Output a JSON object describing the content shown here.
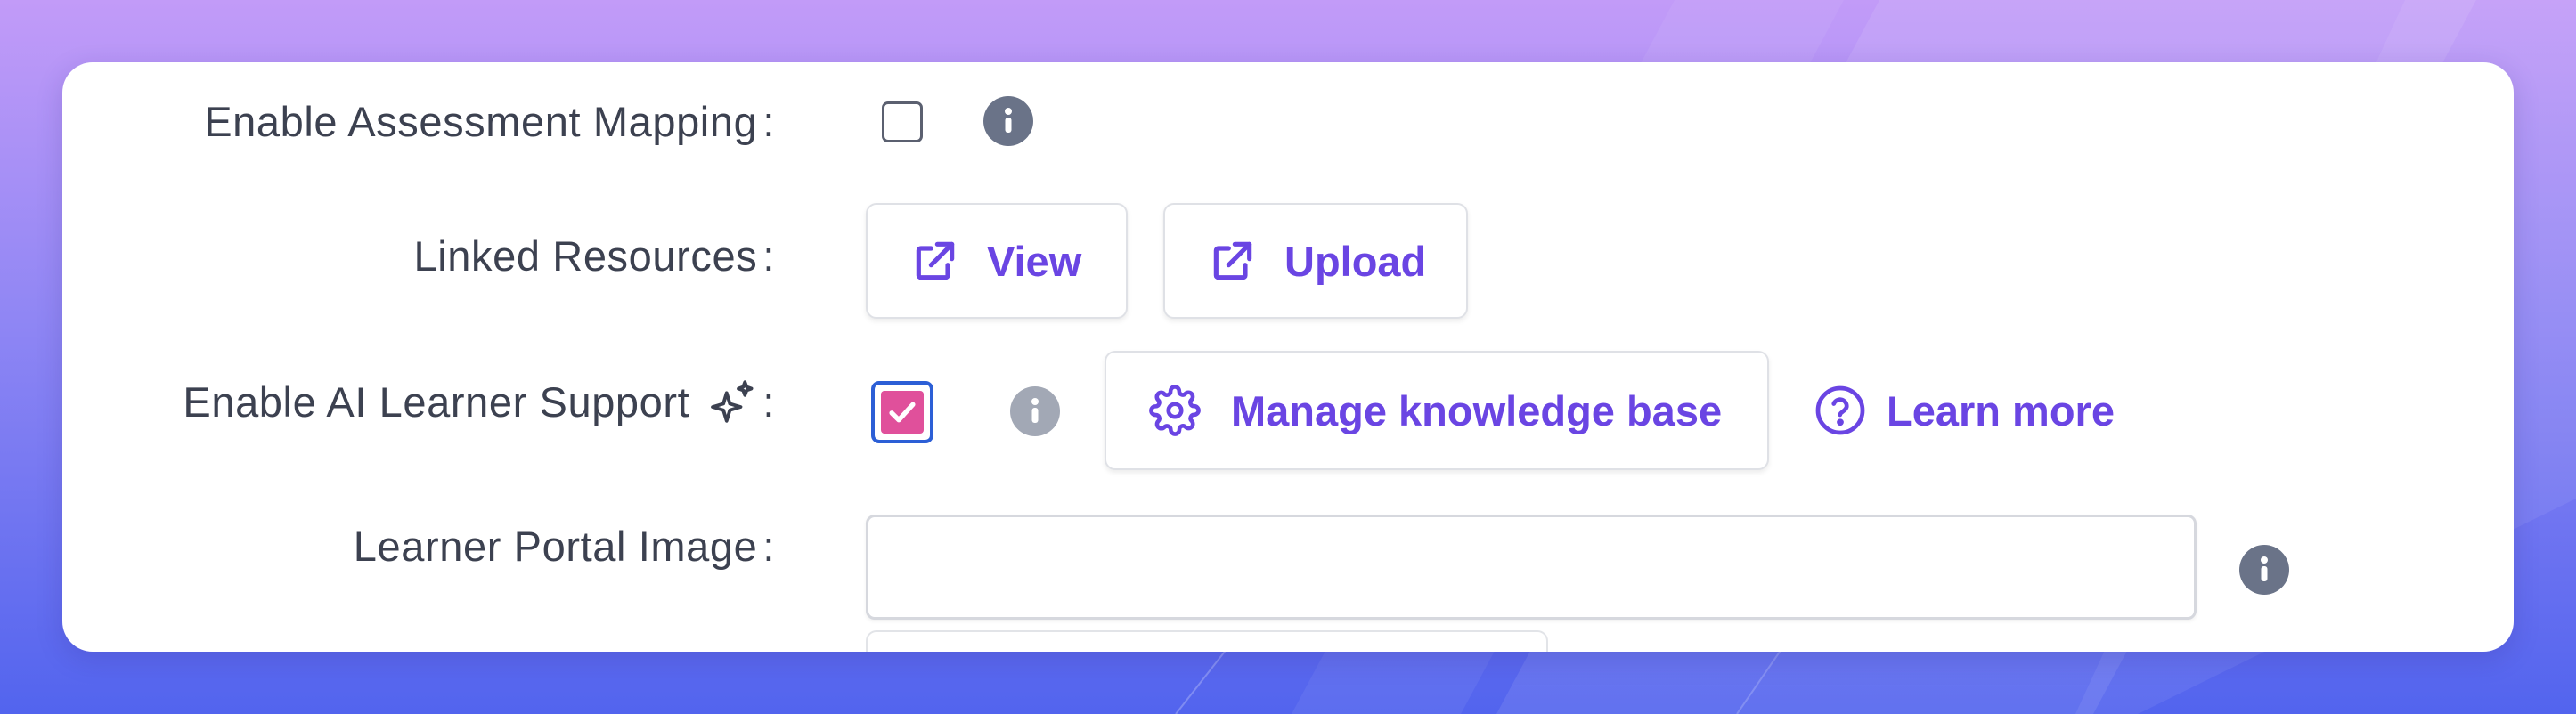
{
  "colors": {
    "accent": "#6a45e3",
    "checkbox_checked": "#e0509b",
    "focus_ring": "#2c5fd6",
    "label_text": "#3c4150",
    "info_icon": "#6a7388"
  },
  "form": {
    "assessment_mapping": {
      "label": "Enable Assessment Mapping",
      "colon": ":",
      "checked": false,
      "info_icon": "info-icon"
    },
    "linked_resources": {
      "label": "Linked Resources",
      "colon": ":",
      "view_label": "View",
      "upload_label": "Upload",
      "icon": "external-link-icon"
    },
    "ai_support": {
      "label": "Enable AI Learner Support",
      "colon": ":",
      "sparkle_icon": "sparkle-icon",
      "checked": true,
      "info_icon": "info-icon",
      "manage_label": "Manage knowledge base",
      "manage_icon": "gear-icon",
      "learn_more_label": "Learn more",
      "learn_more_icon": "help-circle-icon"
    },
    "portal_image": {
      "label": "Learner Portal Image",
      "colon": ":",
      "value": "",
      "info_icon": "info-icon"
    }
  }
}
